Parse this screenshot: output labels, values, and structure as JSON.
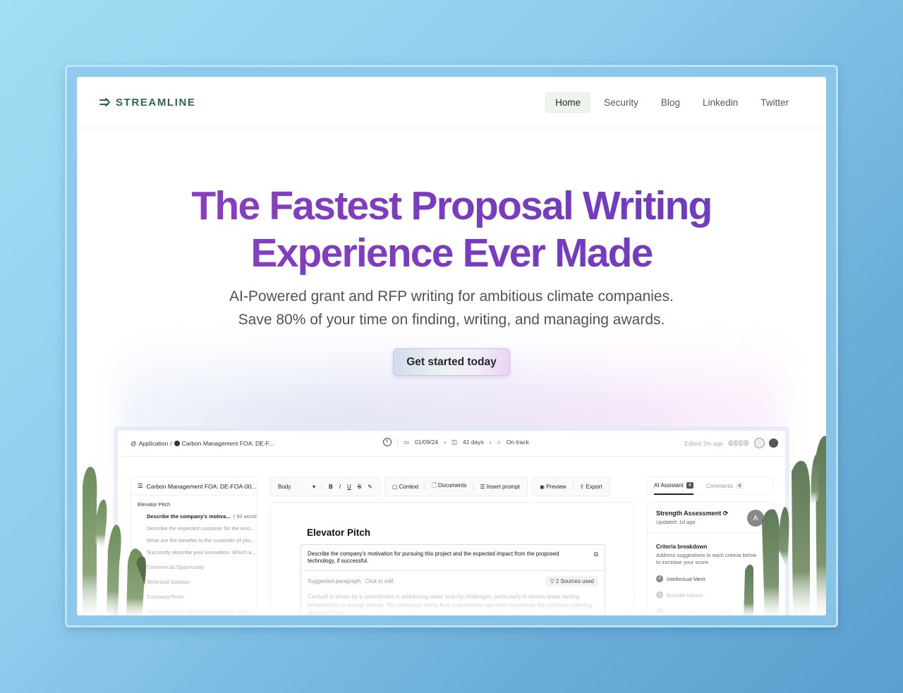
{
  "nav": {
    "logo_text": "STREAMLINE",
    "links": [
      {
        "label": "Home",
        "active": true
      },
      {
        "label": "Security",
        "active": false
      },
      {
        "label": "Blog",
        "active": false
      },
      {
        "label": "Linkedin",
        "active": false
      },
      {
        "label": "Twitter",
        "active": false
      }
    ]
  },
  "hero": {
    "title_line1": "The Fastest Proposal Writing",
    "title_line2": "Experience Ever Made",
    "subtitle_line1": "AI-Powered grant and RFP writing for ambitious climate companies.",
    "subtitle_line2": "Save 80% of your time on finding, writing, and managing awards.",
    "cta_label": "Get started today"
  },
  "app": {
    "breadcrumb": {
      "root": "Application",
      "separator": "/",
      "current": "Carbon Management FOA: DE-F..."
    },
    "meta": {
      "date": "01/09/24",
      "days": "41 days",
      "status": "On track"
    },
    "edited": "Edited 2m ago",
    "outline": {
      "title": "Carbon Management FOA: DE-FOA-00...",
      "section": "Elevator Pitch",
      "items": [
        {
          "label": "Describe the company's motiva...",
          "count": "( 93 words )"
        },
        {
          "label": "Describe the expected customer for the inno..."
        },
        {
          "label": "What are the benefits to the customer of you..."
        },
        {
          "label": "Succinctly describe your innovation. Which a..."
        }
      ],
      "top_sections": [
        "Commercial Opportunity",
        "Technical Solution",
        "Company/Team",
        "Technical Merits, Technical Objectives, And RA..."
      ]
    },
    "toolbar": {
      "style_select": "Body",
      "format_buttons": [
        "B",
        "I",
        "U",
        "S",
        "✎"
      ],
      "context": "Context",
      "documents": "Documents",
      "insert_prompt": "Insert prompt",
      "preview": "Preview",
      "export": "Export"
    },
    "document": {
      "title": "Elevator Pitch",
      "question": "Describe the company's motivation for pursuing this project and the expected impact from the proposed technology, if successful.",
      "suggested_label": "Suggested paragraph:",
      "suggested_hint": "Click to edit",
      "sources": "2 Sources used",
      "body": "CactusX is driven by a commitment to addressing water scarcity challenges, particularly in remote areas lacking infrastructure or energy access. The motivation stems from a biomimetic approach inspired by the moisture-collecting abilities of cacti..."
    },
    "assistant": {
      "tab_ai": "AI Assistant",
      "tab_ai_count": "4",
      "tab_comments": "Comments",
      "tab_comments_count": "4",
      "title": "Strength Assessment",
      "updated": "Updated: 1d ago",
      "avatar_letter": "A",
      "criteria_title": "Criteria breakdown",
      "criteria_desc": "Address suggestions in each criteria below to increase your score.",
      "criteria": [
        {
          "badge": "A",
          "label": "Intellectual Merit"
        },
        {
          "badge": "A",
          "label": "Broader impact"
        },
        {
          "badge": "",
          "label": "Commercialization potential"
        }
      ]
    }
  }
}
